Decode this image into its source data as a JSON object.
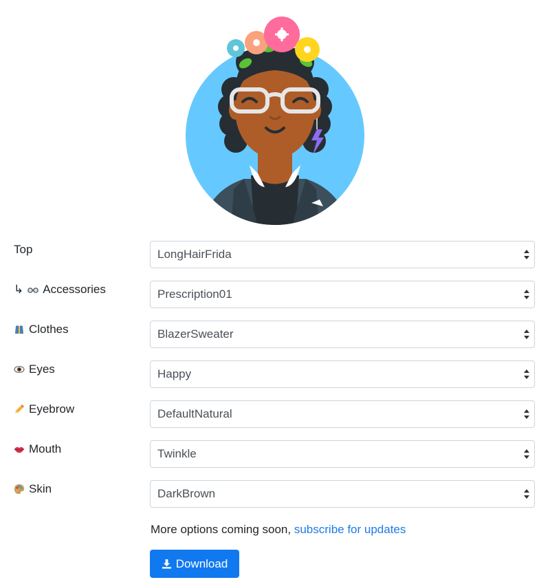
{
  "fields": [
    {
      "label": "Top",
      "value": "LongHairFrida",
      "prefix": "",
      "icon": "none"
    },
    {
      "label": "Accessories",
      "value": "Prescription01",
      "prefix": "↳",
      "icon": "glasses-icon"
    },
    {
      "label": "Clothes",
      "value": "BlazerSweater",
      "prefix": "",
      "icon": "shirt-icon"
    },
    {
      "label": "Eyes",
      "value": "Happy",
      "prefix": "",
      "icon": "eye-icon"
    },
    {
      "label": "Eyebrow",
      "value": "DefaultNatural",
      "prefix": "",
      "icon": "pencil-icon"
    },
    {
      "label": "Mouth",
      "value": "Twinkle",
      "prefix": "",
      "icon": "lips-icon"
    },
    {
      "label": "Skin",
      "value": "DarkBrown",
      "prefix": "",
      "icon": "palette-icon"
    }
  ],
  "note": {
    "text": "More options coming soon, ",
    "link": "subscribe for updates"
  },
  "download": {
    "label": "Download",
    "icon": "download-icon"
  },
  "colors": {
    "accent": "#1179f0",
    "link": "#1e7be6",
    "avatar_bg": "#65c9ff",
    "skin": "#ae5d29",
    "hair": "#262e33",
    "blazer": "#3c4f5c"
  }
}
